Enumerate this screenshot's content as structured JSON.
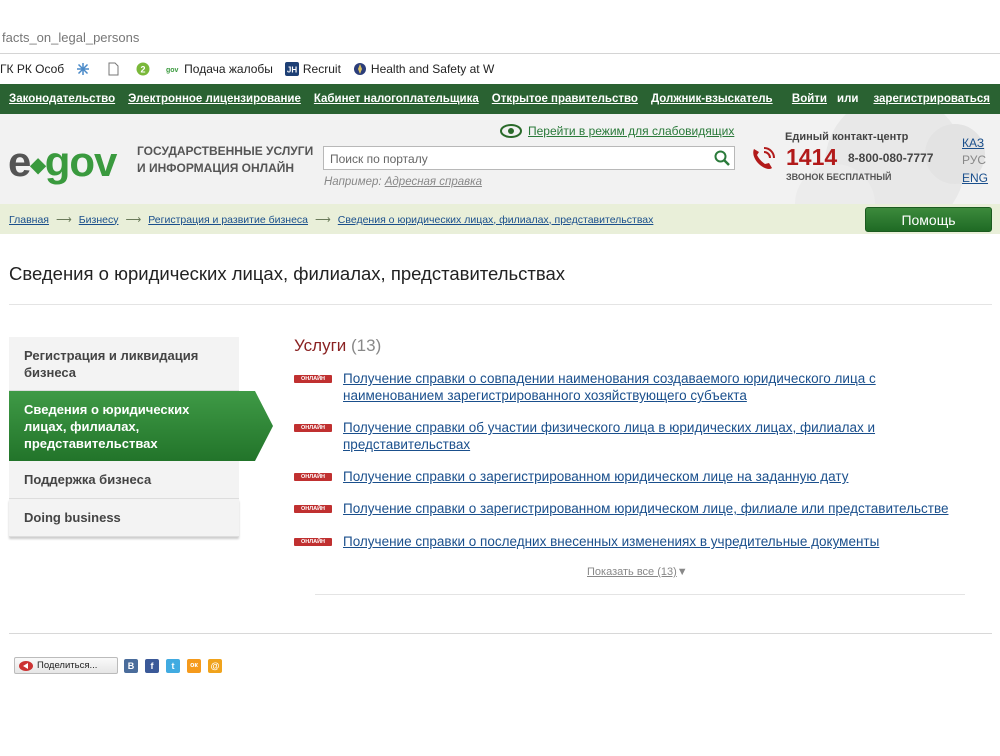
{
  "browser": {
    "url": "facts_on_legal_persons",
    "bookmarks": [
      {
        "label": "ГК РК Особ",
        "icon": "document-icon"
      },
      {
        "label": "",
        "icon": "snowflake-icon"
      },
      {
        "label": "",
        "icon": "blank-page-icon"
      },
      {
        "label": "",
        "icon": "green-circle-icon"
      },
      {
        "label": "Подача жалобы",
        "icon": "egov-icon"
      },
      {
        "label": "Recruit",
        "icon": "jh-icon"
      },
      {
        "label": "Health and Safety at W",
        "icon": "emblem-icon"
      }
    ]
  },
  "topnav": {
    "links": [
      "Законодательство",
      "Электронное лицензирование",
      "Кабинет налогоплательщика",
      "Открытое правительство",
      "Должник-взыскатель"
    ],
    "login": "Войти",
    "or": "или",
    "register": "зарегистрироваться"
  },
  "header": {
    "logo_e": "e",
    "logo_gov": "gov",
    "slogan_line1": "ГОСУДАРСТВЕННЫЕ УСЛУГИ",
    "slogan_line2": "И ИНФОРМАЦИЯ ОНЛАЙН",
    "accessibility_link": "Перейти в режим для слабовидящих",
    "search_placeholder": "Поиск по порталу",
    "example_prefix": "Например:",
    "example_link": "Адресная справка",
    "contact_title": "Единый контакт-центр",
    "phone_short": "1414",
    "phone_long": "8-800-080-7777",
    "phone_free": "ЗВОНОК БЕСПЛАТНЫЙ",
    "languages": [
      "КАЗ",
      "РУС",
      "ENG"
    ],
    "active_language": "РУС"
  },
  "breadcrumb": [
    "Главная",
    "Бизнесу",
    "Регистрация и развитие бизнеса",
    "Сведения о юридических лицах, филиалах, представительствах"
  ],
  "help_button": "Помощь",
  "page_title": "Сведения о юридических лицах, филиалах, представительствах",
  "sidebar": {
    "items": [
      {
        "label_1": "Регистрация и ликвидация",
        "label_2": "бизнеса"
      },
      {
        "label_1": "Сведения о юридических",
        "label_2": "лицах, филиалах,",
        "label_3": "представительствах",
        "active": true
      },
      {
        "label_1": "Поддержка бизнеса"
      },
      {
        "label_1": "Doing business"
      }
    ]
  },
  "services": {
    "title": "Услуги",
    "count": "(13)",
    "badge": "ОНЛАЙН",
    "items": [
      {
        "line1": "Получение справки о совпадении наименования создаваемого юридического лица с",
        "line2": "наименованием зарегистрированного хозяйствующего субъекта"
      },
      {
        "line1": "Получение справки об участии физического лица в юридических лицах, филиалах и",
        "line2": "представительствах"
      },
      {
        "line1": "Получение справки о зарегистрированном юридическом лице на заданную дату"
      },
      {
        "line1": "Получение справки о зарегистрированном юридическом лице, филиале или представительстве"
      },
      {
        "line1": "Получение справки о последних внесенных изменениях в учредительные документы"
      }
    ],
    "show_all": "Показать все (13)"
  },
  "share": {
    "label": "Поделиться...",
    "networks": [
      {
        "name": "vkontakte-icon",
        "glyph": "В",
        "color": "#4a6c9b"
      },
      {
        "name": "facebook-icon",
        "glyph": "f",
        "color": "#3b5998"
      },
      {
        "name": "twitter-icon",
        "glyph": "t",
        "color": "#41abe1"
      },
      {
        "name": "odnoklassniki-icon",
        "glyph": "ок",
        "color": "#f59a1c"
      },
      {
        "name": "mailru-icon",
        "glyph": "@",
        "color": "#f0a31c"
      }
    ]
  }
}
